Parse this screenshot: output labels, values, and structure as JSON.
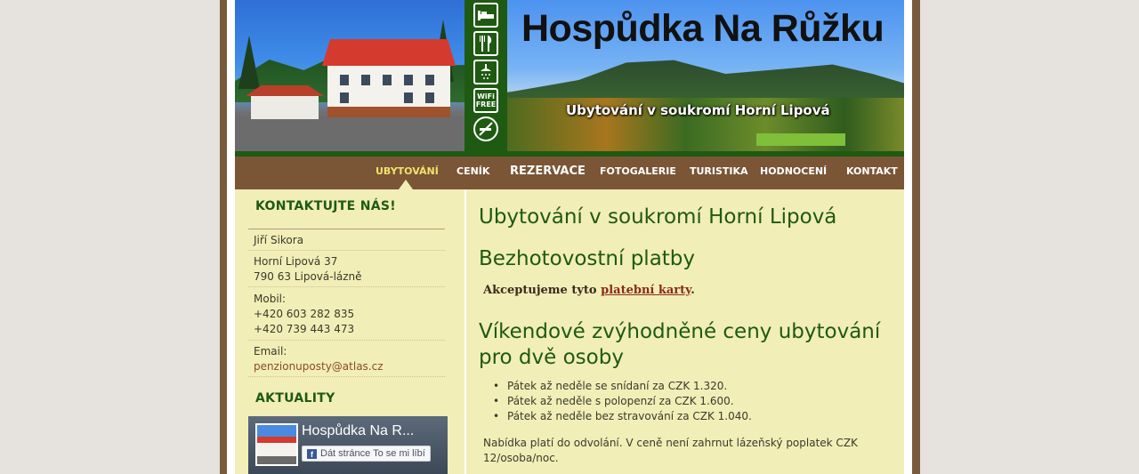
{
  "header": {
    "title": "Hospůdka Na Růžku",
    "subtitle": "Ubytování v soukromí Horní Lipová",
    "icons": [
      "bed-icon",
      "cutlery-icon",
      "shower-icon",
      "wifi-free-icon",
      "no-smoking-icon"
    ],
    "wifi_label_1": "WiFi",
    "wifi_label_2": "FREE"
  },
  "nav": {
    "items": [
      "UBYTOVÁNÍ",
      "CENÍK",
      "REZERVACE",
      "FOTOGALERIE",
      "TURISTIKA",
      "HODNOCENÍ",
      "KONTAKT"
    ],
    "active": "UBYTOVÁNÍ"
  },
  "sidebar": {
    "contact_heading": "KONTAKTUJTE NÁS!",
    "name": "Jiří Sikora",
    "address_1": "Horní Lipová 37",
    "address_2": "790 63 Lipová-lázně",
    "mobile_label": "Mobil:",
    "phone_1": "+420 603 282 835",
    "phone_2": "+420 739 443 473",
    "email_label": "Email:",
    "email": "penzionuposty@atlas.cz",
    "news_heading": "AKTUALITY",
    "fb_page": "Hospůdka Na R...",
    "fb_like": "Dát stránce To se mi líbí"
  },
  "main": {
    "title": "Ubytování v soukromí Horní Lipová",
    "section1_title": "Bezhotovostní platby",
    "card_text": "Akceptujeme tyto ",
    "card_link": "platební karty",
    "card_end": ".",
    "section2_title": "Víkendové zvýhodněné ceny ubytování pro dvě osoby",
    "prices": [
      "Pátek až neděle se snídaní za CZK 1.320.",
      "Pátek až neděle s polopenzí za CZK 1.600.",
      "Pátek až neděle bez stravování za CZK 1.040."
    ],
    "note": "Nabídka platí do odvolání. V ceně není zahrnut lázeňský poplatek CZK 12/osoba/noc."
  },
  "colors": {
    "brand_green": "#1f5a12",
    "nav_brown": "#7a5536",
    "content_bg": "#f2eeb8",
    "nav_active": "#f0e36a"
  }
}
